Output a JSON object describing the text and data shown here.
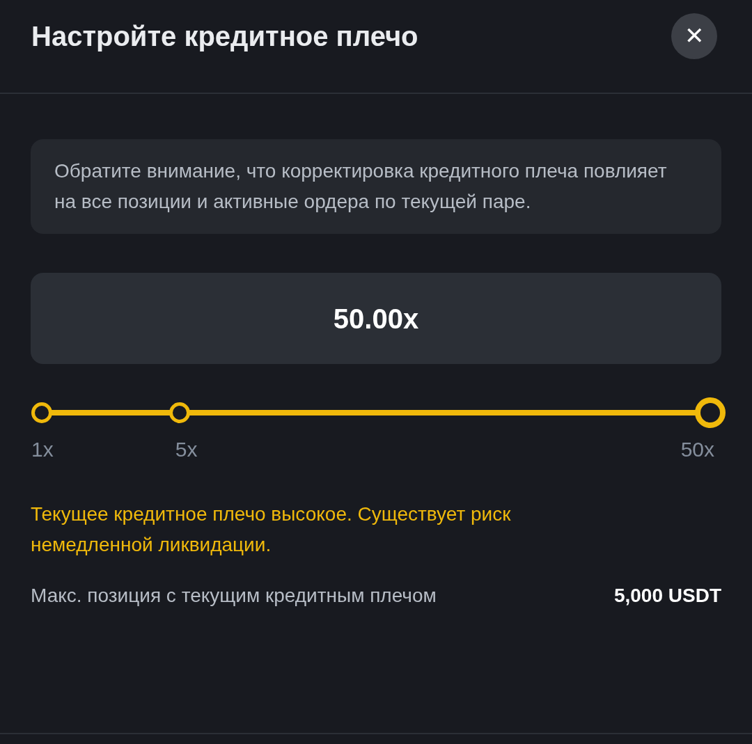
{
  "dialog": {
    "title": "Настройте кредитное плечо",
    "close": "✕"
  },
  "notice": "Обратите внимание, что корректировка кредитного плеча повлияет на все позиции и активные ордера по текущей паре.",
  "leverage_value": "50.00x",
  "slider": {
    "level": 1,
    "marks": [
      {
        "label": "1x",
        "selected": false
      },
      {
        "label": "5x",
        "selected": false
      },
      {
        "label": "50x",
        "selected": true
      }
    ]
  },
  "warning": "Текущее кредитное плечо высокое. Существует риск немедленной ликвидации.",
  "max_position": {
    "label": "Макс. позиция с текущим кредитным плечом",
    "value": "5,000 USDT"
  }
}
